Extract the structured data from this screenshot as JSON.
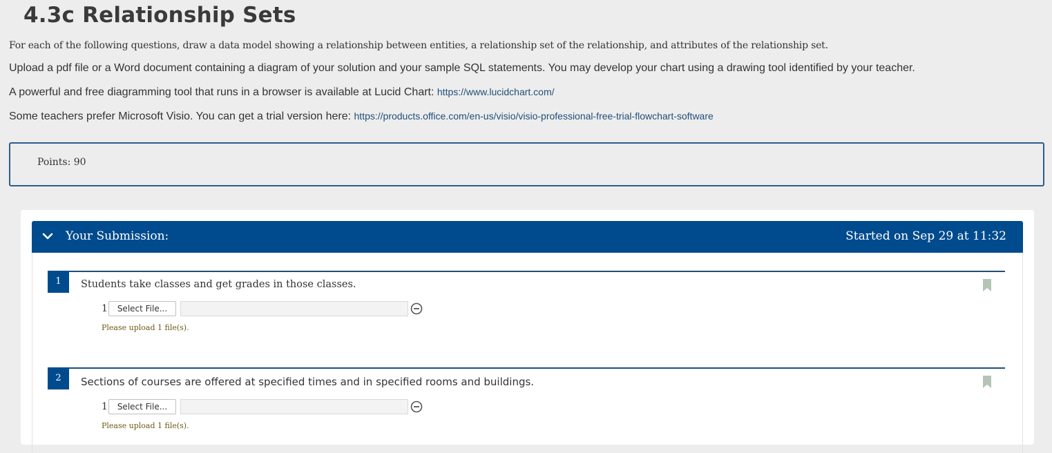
{
  "page": {
    "title": "4.3c Relationship Sets",
    "instructions": "For each of the following questions, draw a data model showing a relationship between entities, a relationship set of the relationship, and attributes of the relationship set.",
    "upload_note": "Upload a pdf file or a Word document containing a diagram of your solution and your sample SQL statements. You may develop your chart using a drawing tool identified by your teacher.",
    "lucid_text": "A powerful and free diagramming tool that runs in a browser is available at Lucid Chart: ",
    "lucid_link": "https://www.lucidchart.com/",
    "visio_text": "Some teachers prefer Microsoft Visio. You can get a trial version here: ",
    "visio_link": "https://products.office.com/en-us/visio/visio-professional-free-trial-flowchart-software"
  },
  "points": {
    "label": "Points:",
    "value": "90"
  },
  "submission": {
    "title": "Your Submission:",
    "started": "Started on Sep 29 at 11:32",
    "icons": {
      "toggle": "chevron-down-icon",
      "bookmark": "bookmark-icon",
      "remove": "minus-circle-icon"
    },
    "colors": {
      "header": "#004b8d",
      "link": "#1f4e79",
      "hint": "#6b5a17"
    },
    "questions": [
      {
        "number": "1",
        "text": "Students take classes and get grades in those classes.",
        "upload_index": "1",
        "select_label": "Select File...",
        "hint": "Please upload 1 file(s)."
      },
      {
        "number": "2",
        "text": "Sections of courses are offered at specified times and in specified rooms and buildings.",
        "upload_index": "1",
        "select_label": "Select File...",
        "hint": "Please upload 1 file(s)."
      }
    ]
  }
}
